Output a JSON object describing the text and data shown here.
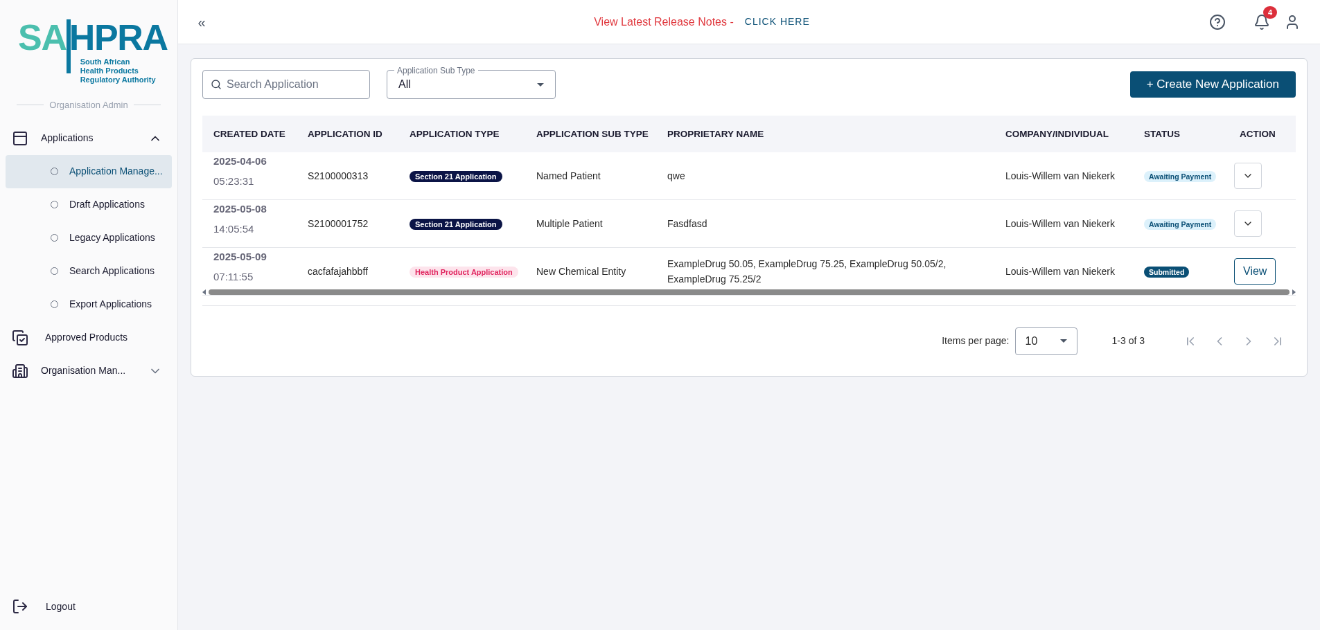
{
  "logo": {
    "left": "SA",
    "right": "HPRA",
    "subtitle": [
      "South African",
      "Health Products",
      "Regulatory Authority"
    ]
  },
  "sidebar": {
    "section_label": "Organisation Admin",
    "items": [
      {
        "kind": "applications",
        "label": "Applications",
        "expanded": true,
        "children": [
          {
            "label": "Application Manage...",
            "selected": true
          },
          {
            "label": "Draft Applications",
            "selected": false
          },
          {
            "label": "Legacy Applications",
            "selected": false
          },
          {
            "label": "Search Applications",
            "selected": false
          },
          {
            "label": "Export Applications",
            "selected": false
          }
        ]
      },
      {
        "kind": "approved",
        "label": "Approved Products"
      },
      {
        "kind": "organisation",
        "label": "Organisation Man...",
        "expanded": false
      }
    ],
    "logout": "Logout"
  },
  "header": {
    "collapse": "«",
    "release_notes": "View Latest Release Notes -",
    "click_here": "CLICK HERE",
    "notification_count": "4"
  },
  "toolbar": {
    "search": {
      "placeholder": "Search Application"
    },
    "sub_type": {
      "label": "Application Sub Type",
      "value": "All"
    },
    "create_button": "+ Create New Application"
  },
  "table": {
    "columns": [
      "CREATED DATE",
      "APPLICATION ID",
      "APPLICATION TYPE",
      "APPLICATION SUB TYPE",
      "PROPRIETARY NAME",
      "COMPANY/INDIVIDUAL",
      "STATUS",
      "ACTION"
    ],
    "rows": [
      {
        "date": "2025-04-06",
        "time": "05:23:31",
        "id": "S2100000313",
        "type": {
          "kind": "section21",
          "label": "Section 21 Application"
        },
        "sub_type": "Named Patient",
        "proprietary": "qwe",
        "company": "Louis-Willem van Niekerk",
        "status": {
          "kind": "awaiting",
          "label": "Awaiting Payment"
        },
        "action": {
          "kind": "menu"
        }
      },
      {
        "date": "2025-05-08",
        "time": "14:05:54",
        "id": "S2100001752",
        "type": {
          "kind": "section21",
          "label": "Section 21 Application"
        },
        "sub_type": "Multiple Patient",
        "proprietary": "Fasdfasd",
        "company": "Louis-Willem van Niekerk",
        "status": {
          "kind": "awaiting",
          "label": "Awaiting Payment"
        },
        "action": {
          "kind": "menu"
        }
      },
      {
        "date": "2025-05-09",
        "time": "07:11:55",
        "id": "cacfafajahbbff",
        "type": {
          "kind": "health",
          "label": "Health Product Application"
        },
        "sub_type": "New Chemical Entity",
        "proprietary": "ExampleDrug 50.05, ExampleDrug 75.25, ExampleDrug 50.05/2, ExampleDrug 75.25/2",
        "company": "Louis-Willem van Niekerk",
        "status": {
          "kind": "submitted",
          "label": "Submitted"
        },
        "action": {
          "kind": "view",
          "label": "View"
        }
      }
    ]
  },
  "pagination": {
    "items_per_page_label": "Items per page:",
    "items_per_page": "10",
    "range": "1-3 of 3"
  }
}
